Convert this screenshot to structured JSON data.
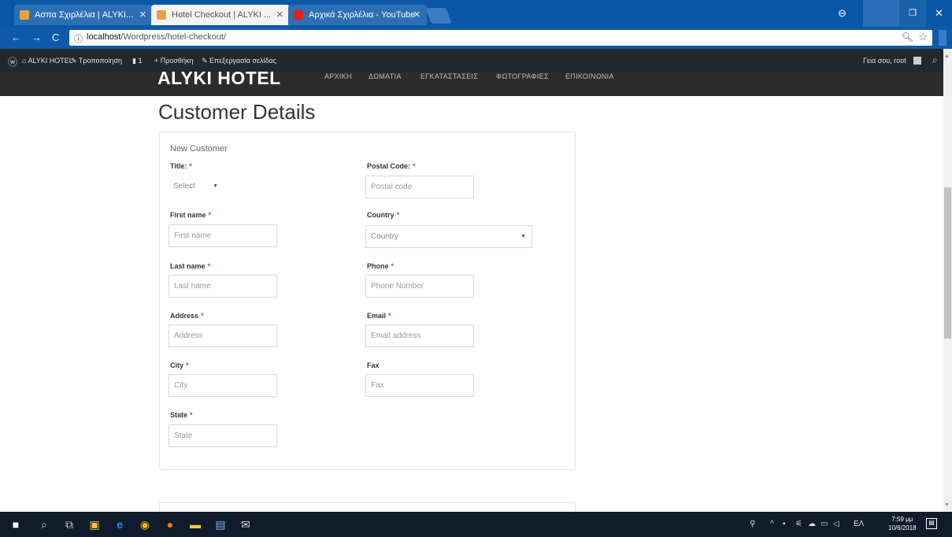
{
  "browser": {
    "tabs": [
      {
        "label": "Ασπα Σχιρλέλια | ALYKI..."
      },
      {
        "label": "Hotel Checkout | ALYKI ..."
      },
      {
        "label": "Αρχικά Σχιρλέλια - YouTube"
      }
    ],
    "url_host": "localhost",
    "url_path": "/Wordpress/hotel-checkout/",
    "nav": {
      "back": "←",
      "forward": "→",
      "reload": "C",
      "info": "ⓘ"
    }
  },
  "adminbar": {
    "items": [
      "ALYKI HOTEL",
      "Τροποποίηση",
      "1",
      "+ Προσθήκη",
      "Επεξεργασία σελίδας"
    ],
    "right": "Γεια σου, root"
  },
  "site": {
    "logo": "ALYKI HOTEL",
    "nav": [
      "ΑΡΧΙΚΗ",
      "ΔΩΜΑΤΙΑ",
      "ΕΓΚΑΤΑΣΤΑΣΕΙΣ",
      "ΦΩΤΟΓΡΑΦΙΕΣ",
      "ΕΠΙΚΟΙΝΩΝΙΑ"
    ]
  },
  "page": {
    "title": "Customer Details",
    "section": "New Customer"
  },
  "form": {
    "required_mark": "*",
    "title": {
      "label": "Title:",
      "value": "Select"
    },
    "first_name": {
      "label": "First name",
      "placeholder": "First name"
    },
    "last_name": {
      "label": "Last name",
      "placeholder": "Last name"
    },
    "address": {
      "label": "Address",
      "placeholder": "Address"
    },
    "city": {
      "label": "City",
      "placeholder": "City"
    },
    "state": {
      "label": "State",
      "placeholder": "State"
    },
    "postal_code": {
      "label": "Postal Code:",
      "placeholder": "Postal code"
    },
    "country": {
      "label": "Country",
      "value": "Country"
    },
    "phone": {
      "label": "Phone",
      "placeholder": "Phone Number"
    },
    "email": {
      "label": "Email",
      "placeholder": "Email address"
    },
    "fax": {
      "label": "Fax",
      "placeholder": "Fax"
    }
  },
  "taskbar": {
    "clock_time": "7:59 μμ",
    "clock_date": "10/6/2018",
    "lang": "ΕΛ"
  }
}
